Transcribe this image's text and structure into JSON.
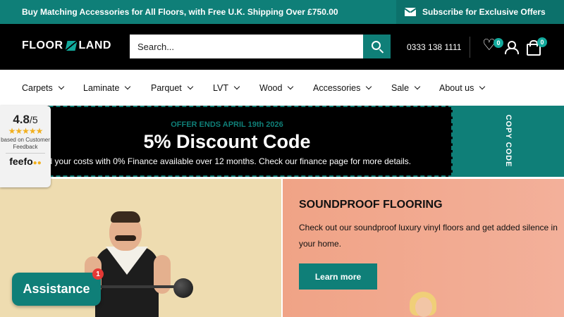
{
  "announcement": {
    "message": "Buy Matching Accessories for All Floors, with Free U.K. Shipping Over £750.00",
    "subscribe": "Subscribe for Exclusive Offers",
    "subscribe_icon": "mail-icon",
    "bg_color": "#0f7f78"
  },
  "header": {
    "logo_left": "FLOOR",
    "logo_right": "LAND",
    "search_placeholder": "Search...",
    "search_icon": "search-icon",
    "phone": "0333 138 1111",
    "wishlist_count": "0",
    "cart_count": "0",
    "icons": [
      "heart-icon",
      "user-icon",
      "bag-icon"
    ]
  },
  "nav": {
    "items": [
      {
        "label": "Carpets"
      },
      {
        "label": "Laminate"
      },
      {
        "label": "Parquet"
      },
      {
        "label": "LVT"
      },
      {
        "label": "Wood"
      },
      {
        "label": "Accessories"
      },
      {
        "label": "Sale"
      },
      {
        "label": "About us"
      }
    ]
  },
  "promo": {
    "offer_ends": "OFFER ENDS APRIL 19th 2026",
    "headline": "5% Discount Code",
    "finance": "ad your costs with 0% Finance available over 12 months. Check our finance page for more details.",
    "copy_code": "COPY CODE"
  },
  "feefo": {
    "rating": "4.8",
    "out_of": "/5",
    "stars": "★★★★★",
    "based_on": "based on Customer Feedback",
    "brand": "feefo",
    "brand_eyes": "●●"
  },
  "hero": {
    "title": "SOUNDPROOF FLOORING",
    "text": "Check out our soundproof luxury vinyl floors and get added silence in your home.",
    "button": "Learn more"
  },
  "assistance": {
    "label": "Assistance",
    "badge": "1"
  },
  "colors": {
    "brand_teal": "#0f7f78",
    "header_black": "#000000",
    "hero_peach": "#f3b09a",
    "hero_cream": "#eedcb0",
    "star_gold": "#f2b01e"
  }
}
